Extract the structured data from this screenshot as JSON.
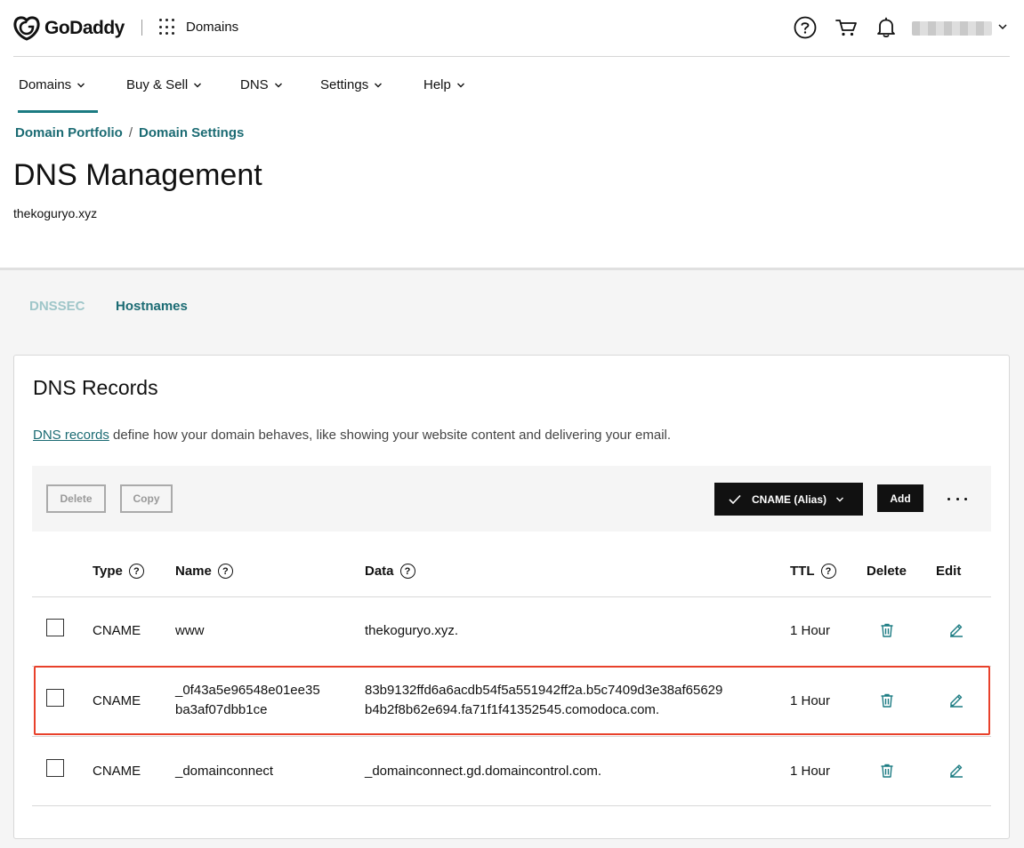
{
  "brand": {
    "name": "GoDaddy"
  },
  "app_switcher": {
    "label": "Domains"
  },
  "nav": [
    {
      "label": "Domains"
    },
    {
      "label": "Buy & Sell"
    },
    {
      "label": "DNS"
    },
    {
      "label": "Settings"
    },
    {
      "label": "Help"
    }
  ],
  "breadcrumb": {
    "item1": "Domain Portfolio",
    "separator": "/",
    "item2": "Domain Settings"
  },
  "page": {
    "title": "DNS Management",
    "domain": "thekoguryo.xyz"
  },
  "subtabs": [
    {
      "label": "DNSSEC"
    },
    {
      "label": "Hostnames"
    }
  ],
  "records_card": {
    "title": "DNS Records",
    "desc_link": "DNS records",
    "desc_rest": " define how your domain behaves, like showing your website content and delivering your email."
  },
  "toolbar": {
    "delete_label": "Delete",
    "copy_label": "Copy",
    "type_selected": "CNAME (Alias)",
    "add_label": "Add"
  },
  "table": {
    "headers": {
      "type": "Type",
      "name": "Name",
      "data": "Data",
      "ttl": "TTL",
      "delete": "Delete",
      "edit": "Edit"
    },
    "help_glyph": "?",
    "rows": [
      {
        "type": "CNAME",
        "name_line1": "www",
        "name_line2": "",
        "data_line1": "thekoguryo.xyz.",
        "data_line2": "",
        "ttl": "1 Hour"
      },
      {
        "type": "CNAME",
        "name_line1": "_0f43a5e96548e01ee35",
        "name_line2": "ba3af07dbb1ce",
        "data_line1": "83b9132ffd6a6acdb54f5a551942ff2a.b5c7409d3e38af65629",
        "data_line2": "b4b2f8b62e694.fa71f1f41352545.comodoca.com.",
        "ttl": "1 Hour"
      },
      {
        "type": "CNAME",
        "name_line1": "_domainconnect",
        "name_line2": "",
        "data_line1": "_domainconnect.gd.domaincontrol.com.",
        "data_line2": "",
        "ttl": "1 Hour"
      }
    ]
  },
  "colors": {
    "accent": "#1b7b82",
    "link": "#1b6b73",
    "highlight": "#e8412b"
  },
  "icons": [
    "godaddy-logo-icon",
    "apps-grid-icon",
    "help-icon",
    "cart-icon",
    "bell-icon",
    "chevron-down-icon",
    "checkmark-icon",
    "more-dots-icon",
    "trash-icon",
    "pencil-icon"
  ]
}
